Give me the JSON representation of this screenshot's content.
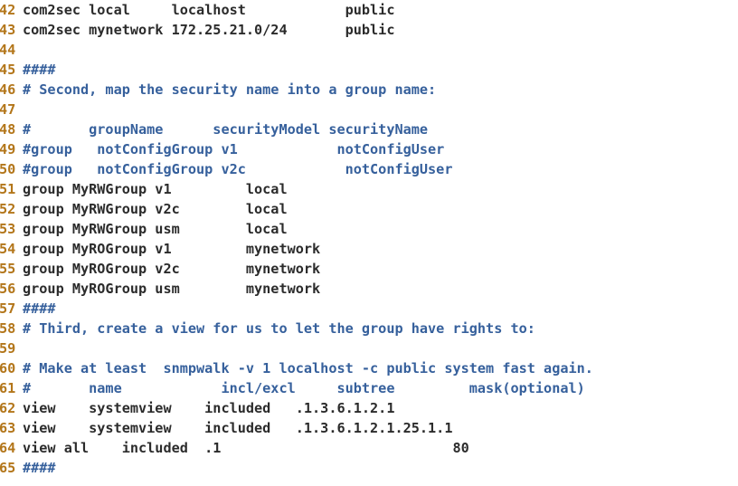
{
  "editor": {
    "file_kind": "snmpd.conf",
    "colors": {
      "background": "#ffffff",
      "line_number": "#b3761a",
      "code_text": "#2b2b2b",
      "comment_text": "#36609c"
    },
    "first_visible_line": 42,
    "last_visible_line": 65,
    "lines": [
      {
        "number": "42",
        "text": "com2sec local     localhost            public",
        "kind": "code"
      },
      {
        "number": "43",
        "text": "com2sec mynetwork 172.25.21.0/24       public",
        "kind": "code"
      },
      {
        "number": "44",
        "text": "",
        "kind": "code"
      },
      {
        "number": "45",
        "text": "####",
        "kind": "comment"
      },
      {
        "number": "46",
        "text": "# Second, map the security name into a group name:",
        "kind": "comment"
      },
      {
        "number": "47",
        "text": "",
        "kind": "code"
      },
      {
        "number": "48",
        "text": "#       groupName      securityModel securityName",
        "kind": "comment"
      },
      {
        "number": "49",
        "text": "#group   notConfigGroup v1            notConfigUser",
        "kind": "comment"
      },
      {
        "number": "50",
        "text": "#group   notConfigGroup v2c            notConfigUser",
        "kind": "comment"
      },
      {
        "number": "51",
        "text": "group MyRWGroup v1         local",
        "kind": "code"
      },
      {
        "number": "52",
        "text": "group MyRWGroup v2c        local",
        "kind": "code"
      },
      {
        "number": "53",
        "text": "group MyRWGroup usm        local",
        "kind": "code"
      },
      {
        "number": "54",
        "text": "group MyROGroup v1         mynetwork",
        "kind": "code"
      },
      {
        "number": "55",
        "text": "group MyROGroup v2c        mynetwork",
        "kind": "code"
      },
      {
        "number": "56",
        "text": "group MyROGroup usm        mynetwork",
        "kind": "code"
      },
      {
        "number": "57",
        "text": "####",
        "kind": "comment"
      },
      {
        "number": "58",
        "text": "# Third, create a view for us to let the group have rights to:",
        "kind": "comment"
      },
      {
        "number": "59",
        "text": "",
        "kind": "code"
      },
      {
        "number": "60",
        "text": "# Make at least  snmpwalk -v 1 localhost -c public system fast again.",
        "kind": "comment"
      },
      {
        "number": "61",
        "text": "#       name            incl/excl     subtree         mask(optional)",
        "kind": "comment"
      },
      {
        "number": "62",
        "text": "view    systemview    included   .1.3.6.1.2.1",
        "kind": "code"
      },
      {
        "number": "63",
        "text": "view    systemview    included   .1.3.6.1.2.1.25.1.1",
        "kind": "code"
      },
      {
        "number": "64",
        "text": "view all    included  .1                            80",
        "kind": "code"
      },
      {
        "number": "65",
        "text": "####",
        "kind": "comment"
      }
    ]
  }
}
